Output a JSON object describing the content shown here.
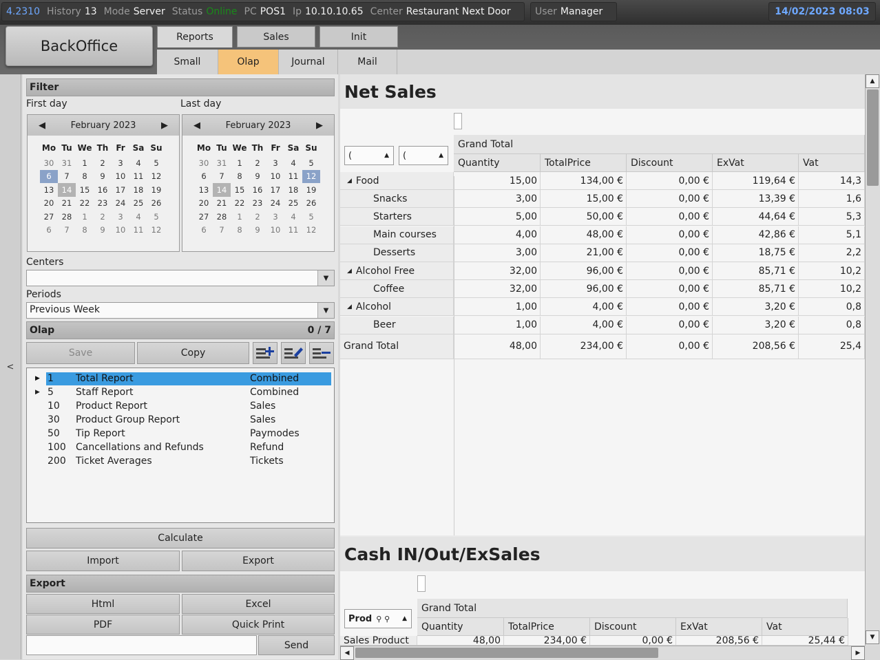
{
  "topbar": {
    "version": "4.2310",
    "history_label": "History",
    "history_value": "13",
    "mode_label": "Mode",
    "mode_value": "Server",
    "status_label": "Status",
    "status_value": "Online",
    "pc_label": "PC",
    "pc_value": "POS1",
    "ip_label": "Ip",
    "ip_value": "10.10.10.65",
    "center_label": "Center",
    "center_value": "Restaurant Next Door",
    "user_label": "User",
    "user_value": "Manager",
    "datetime": "14/02/2023 08:03",
    "status_color": "#1a8a1a",
    "accent_color": "#6ea8ff"
  },
  "nav": {
    "backoffice": "BackOffice",
    "tabs": [
      "Reports",
      "Sales",
      "Init"
    ],
    "subtabs": [
      "Small",
      "Olap",
      "Journal",
      "Mail"
    ],
    "active_subtab_color": "#f5c37a"
  },
  "collapse_label": "<",
  "filter": {
    "title": "Filter",
    "first_day_label": "First day",
    "last_day_label": "Last day",
    "cal_left": {
      "month": "February 2023"
    },
    "cal_right": {
      "month": "February 2023"
    },
    "dow": [
      "Mo",
      "Tu",
      "We",
      "Th",
      "Fr",
      "Sa",
      "Su"
    ],
    "days": [
      "30",
      "31",
      "1",
      "2",
      "3",
      "4",
      "5",
      "6",
      "7",
      "8",
      "9",
      "10",
      "11",
      "12",
      "13",
      "14",
      "15",
      "16",
      "17",
      "18",
      "19",
      "20",
      "21",
      "22",
      "23",
      "24",
      "25",
      "26",
      "27",
      "28",
      "1",
      "2",
      "3",
      "4",
      "5",
      "6",
      "7",
      "8",
      "9",
      "10",
      "11",
      "12"
    ],
    "centers_label": "Centers",
    "centers_value": "",
    "periods_label": "Periods",
    "periods_value": "Previous Week"
  },
  "olap": {
    "title": "Olap",
    "count": "0  /  7",
    "save": "Save",
    "copy": "Copy",
    "reports": [
      {
        "id": "1",
        "name": "Total Report",
        "type": "Combined"
      },
      {
        "id": "5",
        "name": "Staff Report",
        "type": "Combined"
      },
      {
        "id": "10",
        "name": "Product Report",
        "type": "Sales"
      },
      {
        "id": "30",
        "name": "Product Group Report",
        "type": "Sales"
      },
      {
        "id": "50",
        "name": "Tip Report",
        "type": "Paymodes"
      },
      {
        "id": "100",
        "name": "Cancellations and Refunds",
        "type": "Refund"
      },
      {
        "id": "200",
        "name": "Ticket Averages",
        "type": "Tickets"
      }
    ],
    "calculate": "Calculate",
    "import": "Import",
    "export": "Export"
  },
  "export": {
    "title": "Export",
    "html": "Html",
    "excel": "Excel",
    "pdf": "PDF",
    "quick_print": "Quick Print",
    "send": "Send",
    "email_value": ""
  },
  "net_sales": {
    "title": "Net Sales",
    "grand_total_header": "Grand Total",
    "filter1": "(",
    "filter2": "(",
    "columns": [
      "Quantity",
      "TotalPrice",
      "Discount",
      "ExVat",
      "Vat"
    ],
    "rows": [
      {
        "label": "Food",
        "group": true,
        "values": [
          "15,00",
          "134,00 €",
          "0,00 €",
          "119,64 €",
          "14,3"
        ]
      },
      {
        "label": "Snacks",
        "group": false,
        "values": [
          "3,00",
          "15,00 €",
          "0,00 €",
          "13,39 €",
          "1,6"
        ]
      },
      {
        "label": "Starters",
        "group": false,
        "values": [
          "5,00",
          "50,00 €",
          "0,00 €",
          "44,64 €",
          "5,3"
        ]
      },
      {
        "label": "Main courses",
        "group": false,
        "values": [
          "4,00",
          "48,00 €",
          "0,00 €",
          "42,86 €",
          "5,1"
        ]
      },
      {
        "label": "Desserts",
        "group": false,
        "values": [
          "3,00",
          "21,00 €",
          "0,00 €",
          "18,75 €",
          "2,2"
        ]
      },
      {
        "label": "Alcohol Free",
        "group": true,
        "values": [
          "32,00",
          "96,00 €",
          "0,00 €",
          "85,71 €",
          "10,2"
        ]
      },
      {
        "label": "Coffee",
        "group": false,
        "values": [
          "32,00",
          "96,00 €",
          "0,00 €",
          "85,71 €",
          "10,2"
        ]
      },
      {
        "label": "Alcohol",
        "group": true,
        "values": [
          "1,00",
          "4,00 €",
          "0,00 €",
          "3,20 €",
          "0,8"
        ]
      },
      {
        "label": "Beer",
        "group": false,
        "values": [
          "1,00",
          "4,00 €",
          "0,00 €",
          "3,20 €",
          "0,8"
        ]
      }
    ],
    "total": {
      "label": "Grand Total",
      "values": [
        "48,00",
        "234,00 €",
        "0,00 €",
        "208,56 €",
        "25,4"
      ]
    }
  },
  "cash": {
    "title": "Cash IN/Out/ExSales",
    "grand_total_header": "Grand Total",
    "filter": "Prod",
    "columns": [
      "Quantity",
      "TotalPrice",
      "Discount",
      "ExVat",
      "Vat"
    ],
    "row_label": "Sales Product",
    "row_values": [
      "48,00",
      "234,00 €",
      "0,00 €",
      "208,56 €",
      "25,44 €"
    ]
  }
}
